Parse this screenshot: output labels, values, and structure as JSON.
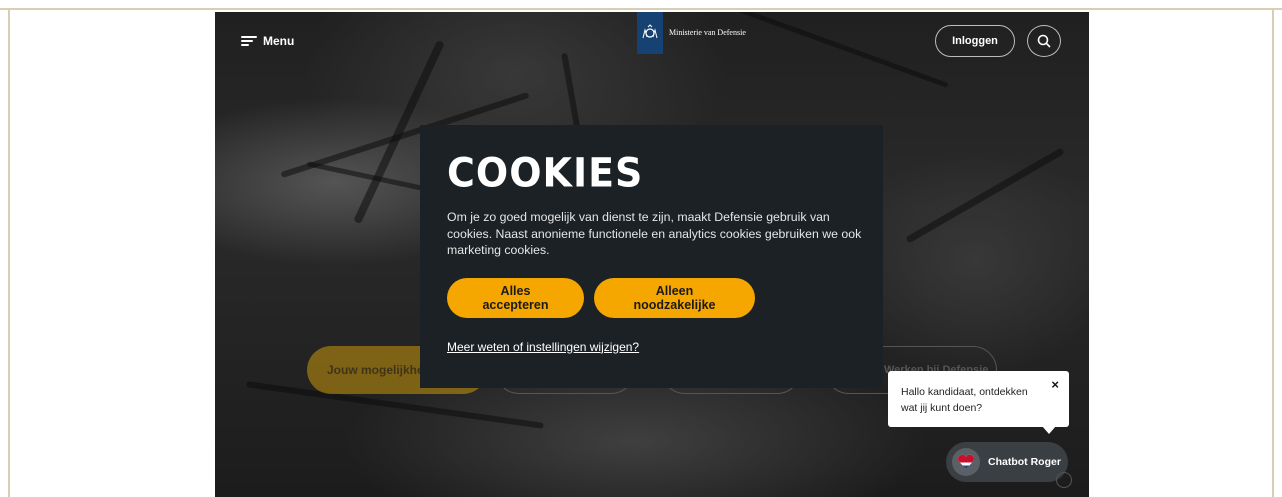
{
  "header": {
    "menu_label": "Menu",
    "logo_text": "Ministerie van Defensie",
    "login_label": "Inloggen"
  },
  "hero": {
    "primary_pill": "Jouw mogelijkheden",
    "ghost_pill_right": "Werken bij Defensie"
  },
  "cookie_modal": {
    "title": "COOKIES",
    "body": "Om je zo goed mogelijk van dienst te zijn, maakt Defensie gebruik van cookies. Naast anonieme functionele en analytics cookies gebruiken we ook marketing cookies.",
    "accept_all_label": "Alles accepteren",
    "necessary_only_label": "Alleen noodzakelijke",
    "settings_link": "Meer weten of instellingen wijzigen?"
  },
  "chat": {
    "bubble_text": "Hallo kandidaat, ontdekken wat jij kunt doen?",
    "close_glyph": "×",
    "chatbot_label": "Chatbot Roger"
  },
  "colors": {
    "accent": "#f5a700",
    "modal_bg": "#1c2125",
    "logo_bg": "#154273"
  }
}
